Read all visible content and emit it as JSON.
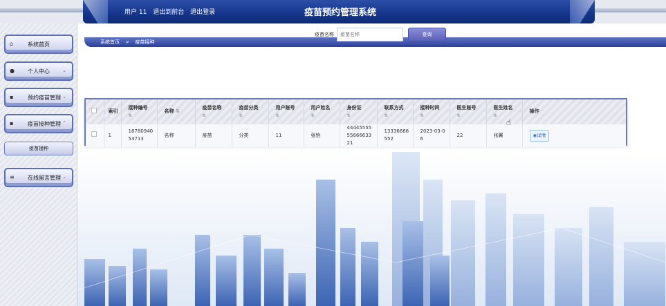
{
  "header": {
    "user": "用户 11",
    "goto_front": "退出到前台",
    "logout": "退出登录",
    "title": "疫苗预约管理系统"
  },
  "sidebar": {
    "items": [
      {
        "label": "系统首页",
        "icon": "home-icon"
      },
      {
        "label": "个人中心",
        "icon": "user-icon"
      },
      {
        "label": "预约疫苗管理",
        "icon": "grid-icon"
      },
      {
        "label": "疫苗接种管理",
        "icon": "grid-icon"
      },
      {
        "label": "疫苗接种",
        "icon": ""
      },
      {
        "label": "在线留言管理",
        "icon": "sliders-icon"
      }
    ]
  },
  "search": {
    "label": "疫苗名称",
    "placeholder": "疫苗名称",
    "button": "查询"
  },
  "breadcrumb": {
    "home": "系统首页",
    "sep": ">",
    "current": "疫苗接种"
  },
  "table": {
    "headers": [
      "索引",
      "接种编号",
      "名称",
      "疫苗名称",
      "疫苗分类",
      "用户账号",
      "用户姓名",
      "身份证",
      "联系方式",
      "接种时间",
      "医生账号",
      "医生姓名",
      "操作"
    ],
    "rows": [
      {
        "index": "1",
        "code": "1678094053713",
        "name": "名称",
        "vaccine": "疫苗",
        "category": "分类",
        "account": "11",
        "username": "张怡",
        "idcard": "444455555566663321",
        "phone": "13336666552",
        "time": "2023-03-06",
        "doctor_account": "22",
        "doctor_name": "张翼",
        "action": "详情"
      }
    ]
  }
}
